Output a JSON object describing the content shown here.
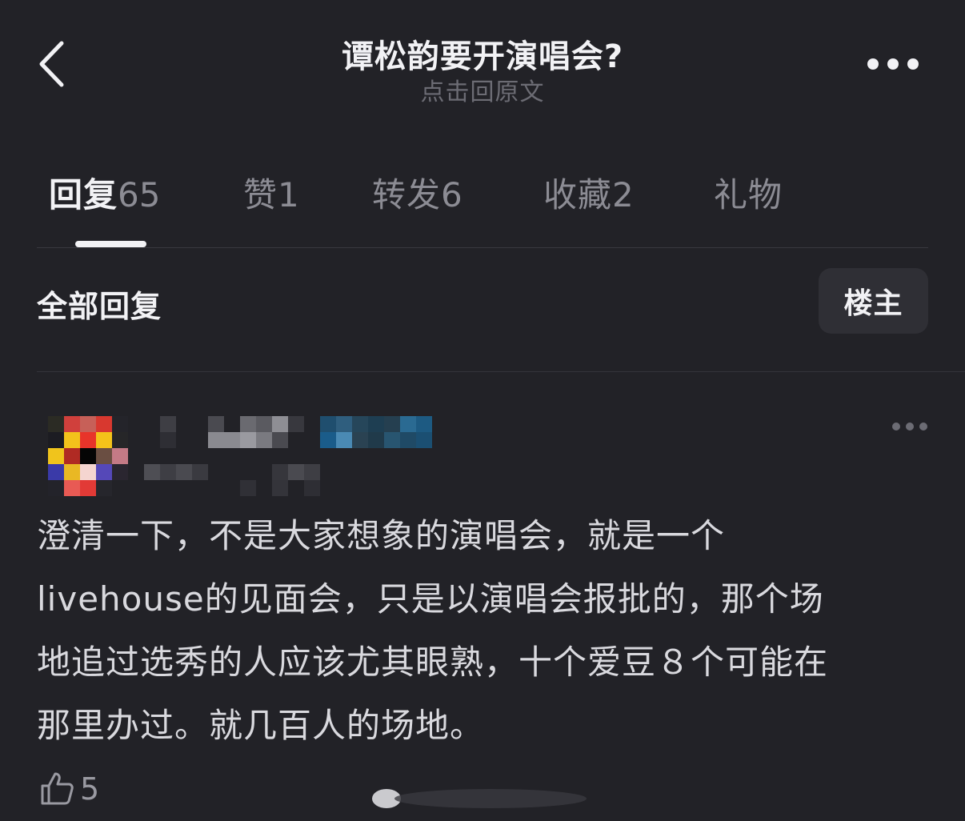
{
  "header": {
    "back_icon": "chevron-left-icon",
    "title": "谭松韵要开演唱会?",
    "subtitle": "点击回原文",
    "more_icon": "more-horizontal-icon"
  },
  "tabs": [
    {
      "label": "回复",
      "count": "65",
      "active": true
    },
    {
      "label": "赞",
      "count": "1",
      "active": false
    },
    {
      "label": "转发",
      "count": "6",
      "active": false
    },
    {
      "label": "收藏",
      "count": "2",
      "active": false
    },
    {
      "label": "礼物",
      "count": "",
      "active": false
    }
  ],
  "filter": {
    "all_label": "全部回复",
    "op_label": "楼主"
  },
  "reply": {
    "lines": [
      "澄清一下，不是大家想象的演唱会，就是一个",
      "livehouse的见面会，只是以演唱会报批的，那个场",
      "地追过选秀的人应该尤其眼熟，十个爱豆８个可能在",
      "那里办过。就几百人的场地。"
    ],
    "likes": "5",
    "like_icon": "thumbs-up-icon",
    "more_icon": "more-horizontal-icon"
  },
  "colors": {
    "background": "#222227",
    "text_primary": "#f2f2f5",
    "text_secondary": "#8c8c94",
    "button_bg": "#2f2f35"
  }
}
